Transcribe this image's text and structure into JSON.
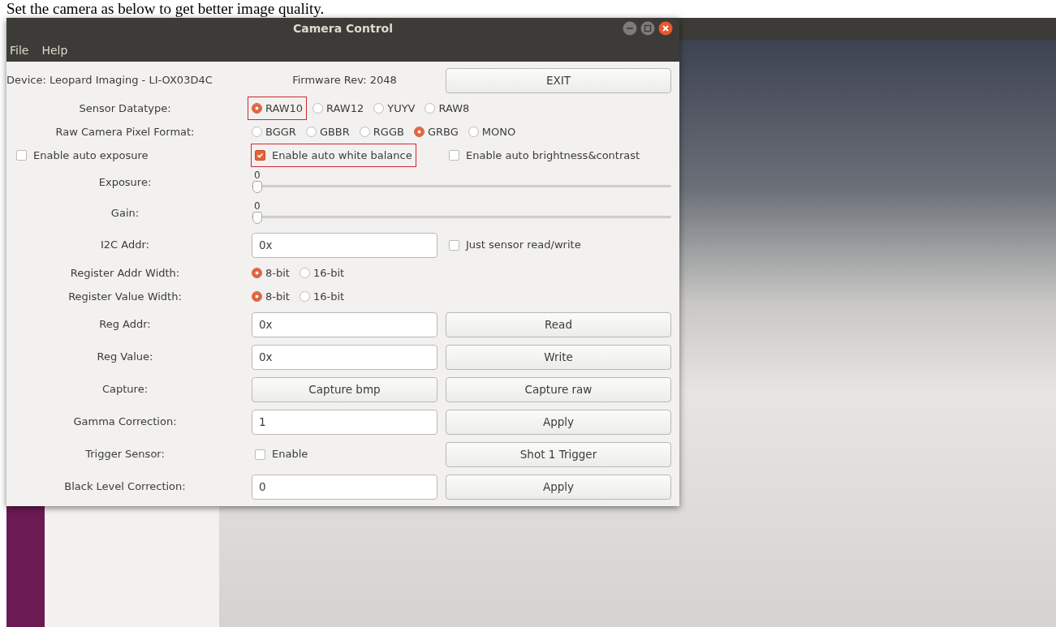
{
  "caption": "Set the camera as below to get better image quality.",
  "dialog": {
    "title": "Camera Control",
    "menu": [
      "File",
      "Help"
    ],
    "rows": [
      {
        "cells": [
          {
            "kind": "text",
            "text": "Device: Leopard Imaging - LI-OX03D4C"
          },
          {
            "kind": "text",
            "text": "Firmware Rev: 2048"
          },
          {
            "kind": "button",
            "text": "EXIT"
          }
        ]
      },
      {
        "cells": [
          {
            "kind": "label",
            "text": "Sensor Datatype:"
          },
          {
            "kind": "radios",
            "options": [
              {
                "label": "RAW10",
                "selected": true,
                "highlighted": true
              },
              {
                "label": "RAW12",
                "selected": false,
                "highlighted": false
              },
              {
                "label": "YUYV",
                "selected": false,
                "highlighted": false
              },
              {
                "label": "RAW8",
                "selected": false,
                "highlighted": false
              }
            ]
          }
        ]
      },
      {
        "cells": [
          {
            "kind": "label",
            "text": "Raw Camera Pixel Format:"
          },
          {
            "kind": "radios",
            "options": [
              {
                "label": "BGGR",
                "selected": false,
                "highlighted": false
              },
              {
                "label": "GBBR",
                "selected": false,
                "highlighted": false
              },
              {
                "label": "RGGB",
                "selected": false,
                "highlighted": false
              },
              {
                "label": "GRBG",
                "selected": true,
                "highlighted": false
              },
              {
                "label": "MONO",
                "selected": false,
                "highlighted": false
              }
            ]
          }
        ]
      },
      {
        "cells": [
          {
            "kind": "check",
            "label": "Enable auto exposure",
            "checked": false,
            "highlighted": false
          },
          {
            "kind": "check",
            "label": "Enable auto white balance",
            "checked": true,
            "highlighted": true
          },
          {
            "kind": "check",
            "label": "Enable auto brightness&contrast",
            "checked": false,
            "highlighted": false
          }
        ]
      },
      {
        "cells": [
          {
            "kind": "label",
            "text": "Exposure:"
          },
          {
            "kind": "slider",
            "value": "0",
            "level": 0
          }
        ]
      },
      {
        "cells": [
          {
            "kind": "label",
            "text": "Gain:"
          },
          {
            "kind": "slider",
            "value": "0",
            "level": 0
          }
        ]
      },
      {
        "cells": [
          {
            "kind": "label",
            "text": "I2C Addr:"
          },
          {
            "kind": "field",
            "value": "0x"
          },
          {
            "kind": "check",
            "label": "Just sensor read/write",
            "checked": false,
            "highlighted": false
          }
        ]
      },
      {
        "cells": [
          {
            "kind": "label",
            "text": "Register Addr Width:"
          },
          {
            "kind": "radios",
            "options": [
              {
                "label": "8-bit",
                "selected": true,
                "highlighted": false
              },
              {
                "label": "16-bit",
                "selected": false,
                "highlighted": false
              }
            ]
          }
        ]
      },
      {
        "cells": [
          {
            "kind": "label",
            "text": "Register Value Width:"
          },
          {
            "kind": "radios",
            "options": [
              {
                "label": "8-bit",
                "selected": true,
                "highlighted": false
              },
              {
                "label": "16-bit",
                "selected": false,
                "highlighted": false
              }
            ]
          }
        ]
      },
      {
        "cells": [
          {
            "kind": "label",
            "text": "Reg Addr:"
          },
          {
            "kind": "field",
            "value": "0x"
          },
          {
            "kind": "button",
            "text": "Read"
          }
        ]
      },
      {
        "cells": [
          {
            "kind": "label",
            "text": "Reg Value:"
          },
          {
            "kind": "field",
            "value": "0x"
          },
          {
            "kind": "button",
            "text": "Write"
          }
        ]
      },
      {
        "cells": [
          {
            "kind": "label",
            "text": "Capture:"
          },
          {
            "kind": "button",
            "text": "Capture bmp"
          },
          {
            "kind": "button",
            "text": "Capture raw"
          }
        ]
      },
      {
        "cells": [
          {
            "kind": "label",
            "text": "Gamma Correction:"
          },
          {
            "kind": "field",
            "value": "1"
          },
          {
            "kind": "button",
            "text": "Apply"
          }
        ]
      },
      {
        "cells": [
          {
            "kind": "label",
            "text": "Trigger Sensor:"
          },
          {
            "kind": "check",
            "label": "Enable",
            "checked": false,
            "highlighted": false
          },
          {
            "kind": "button",
            "text": "Shot 1 Trigger"
          }
        ]
      },
      {
        "cells": [
          {
            "kind": "label",
            "text": "Black Level Correction:"
          },
          {
            "kind": "field",
            "value": "0"
          },
          {
            "kind": "button",
            "text": "Apply"
          }
        ]
      }
    ]
  }
}
